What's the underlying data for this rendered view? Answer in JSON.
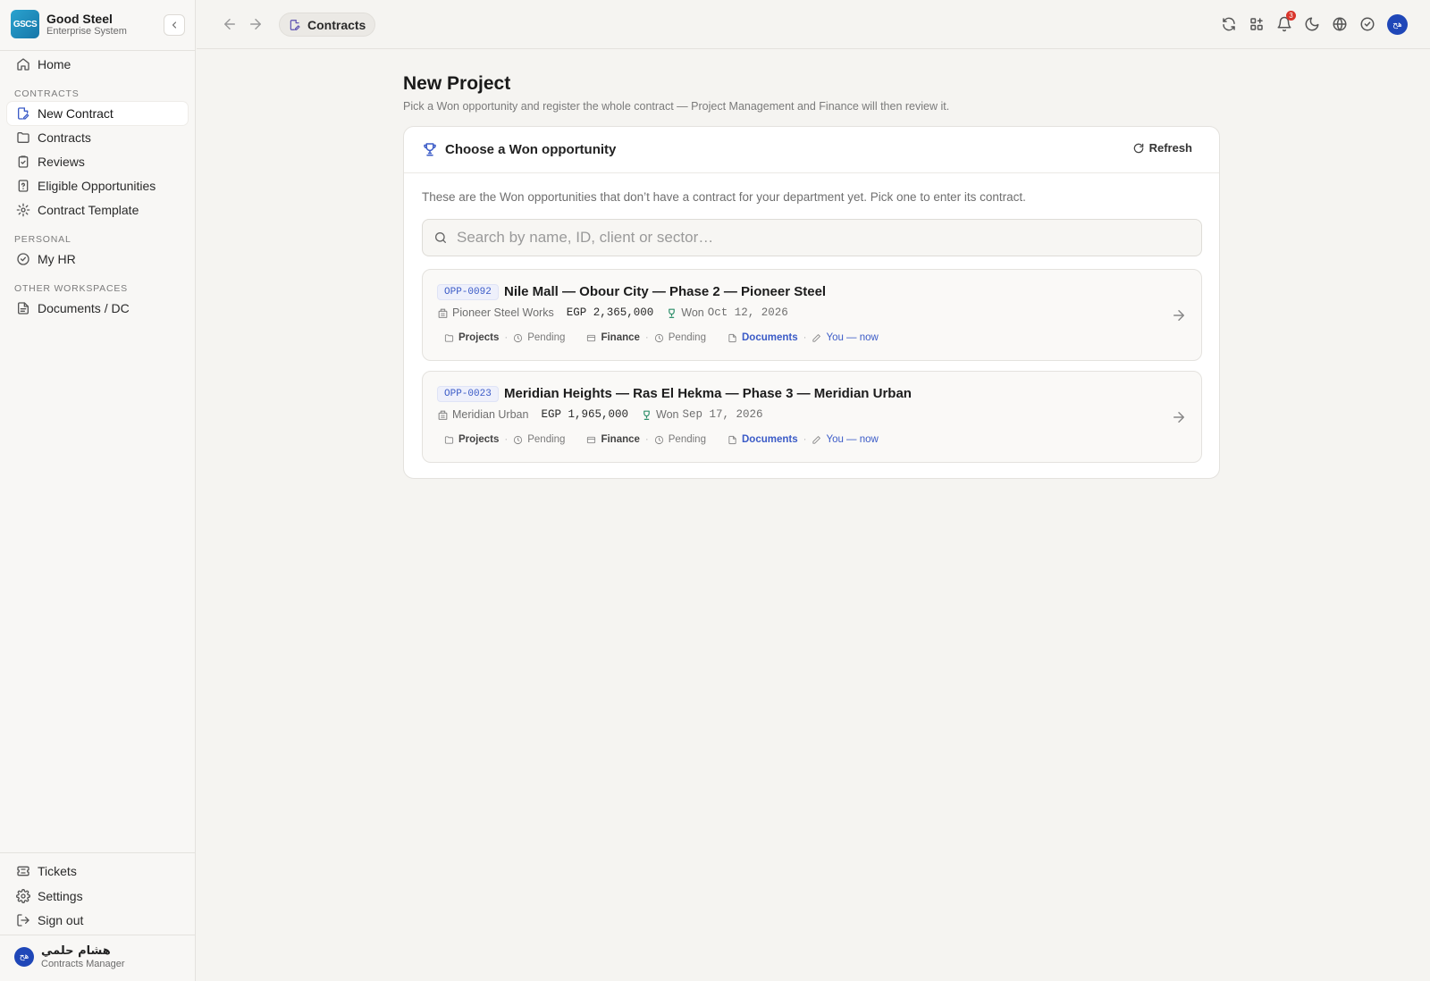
{
  "brand": {
    "logo_text": "GSCS",
    "name": "Good Steel",
    "subtitle": "Enterprise System"
  },
  "sidebar": {
    "home": "Home",
    "sections": {
      "contracts": "CONTRACTS",
      "personal": "PERSONAL",
      "other": "OTHER WORKSPACES"
    },
    "items": [
      {
        "label": "New Contract",
        "icon": "file-edit-icon",
        "active": true
      },
      {
        "label": "Contracts",
        "icon": "folder-icon"
      },
      {
        "label": "Reviews",
        "icon": "clipboard-check-icon"
      },
      {
        "label": "Eligible Opportunities",
        "icon": "file-question-icon"
      },
      {
        "label": "Contract Template",
        "icon": "gear-icon"
      }
    ],
    "my_hr": "My HR",
    "documents": "Documents / DC",
    "bottom": {
      "tickets": "Tickets",
      "settings": "Settings",
      "sign_out": "Sign out"
    },
    "user": {
      "initials": "هح",
      "name": "هشام حلمي",
      "role": "Contracts Manager"
    }
  },
  "topbar": {
    "breadcrumb": "Contracts",
    "notification_count": "3",
    "avatar_initials": "هح"
  },
  "main": {
    "title": "New Project",
    "subtitle": "Pick a Won opportunity and register the whole contract — Project Management and Finance will then review it.",
    "card": {
      "title": "Choose a Won opportunity",
      "refresh": "Refresh",
      "description": "These are the Won opportunities that don’t have a contract for your department yet. Pick one to enter its contract.",
      "search_placeholder": "Search by name, ID, client or sector…",
      "opportunities": [
        {
          "id": "OPP-0092",
          "name": "Nile Mall — Obour City — Phase 2 — Pioneer Steel",
          "client": "Pioneer Steel Works",
          "amount": "EGP 2,365,000",
          "won_label": "Won",
          "won_date": "Oct 12, 2026",
          "projects_label": "Projects",
          "projects_status": "Pending",
          "finance_label": "Finance",
          "finance_status": "Pending",
          "documents_label": "Documents",
          "editor": "You — now"
        },
        {
          "id": "OPP-0023",
          "name": "Meridian Heights — Ras El Hekma — Phase 3 — Meridian Urban",
          "client": "Meridian Urban",
          "amount": "EGP 1,965,000",
          "won_label": "Won",
          "won_date": "Sep 17, 2026",
          "projects_label": "Projects",
          "projects_status": "Pending",
          "finance_label": "Finance",
          "finance_status": "Pending",
          "documents_label": "Documents",
          "editor": "You — now"
        }
      ]
    }
  },
  "colors": {
    "accent": "#3b5bc7",
    "badge": "#d9352b",
    "avatar": "#1f47b8"
  }
}
